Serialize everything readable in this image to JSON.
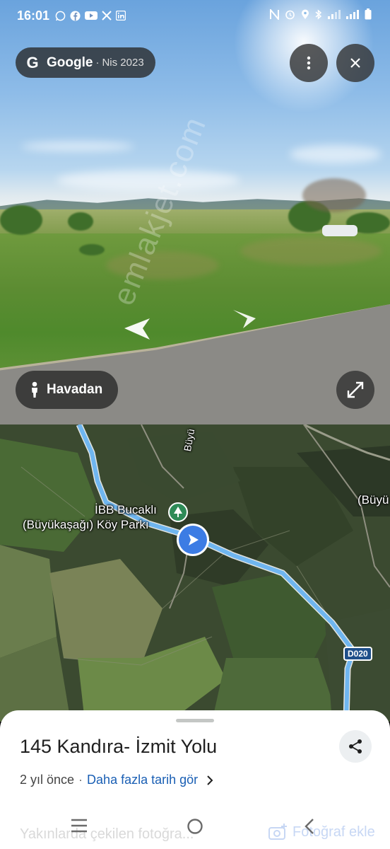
{
  "status_bar": {
    "time": "16:01",
    "left_icons": [
      "whatsapp-icon",
      "facebook-icon",
      "youtube-icon",
      "x-icon",
      "linkedin-icon"
    ],
    "right_icons": [
      "nfc-icon",
      "alarm-icon",
      "location-icon",
      "bluetooth-icon",
      "signal-icon",
      "network-icon",
      "battery-icon"
    ]
  },
  "streetview": {
    "brand": "Google",
    "separator": "·",
    "capture_date": "Nis 2023",
    "aerial_label": "Havadan"
  },
  "map": {
    "poi_label_line1": "İBB Bucaklı",
    "poi_label_line2": "(Büyükaşağı) Köy Parkı",
    "edge_label": "(Büyü",
    "road_label": "Büyü",
    "route_shield": "D020",
    "watermark": "emlakjet.com"
  },
  "sheet": {
    "title": "145 Kandıra- İzmit Yolu",
    "ago": "2 yıl önce",
    "separator": "·",
    "history_link": "Daha fazla tarih gör",
    "nearby": "Yakınlarda çekilen fotoğra...",
    "add_photo": "Fotoğraf ekle"
  },
  "colors": {
    "accent": "#1a5fb4",
    "route": "#6fb6f0",
    "location": "#3c7ce4",
    "poi": "#2e8b57"
  }
}
